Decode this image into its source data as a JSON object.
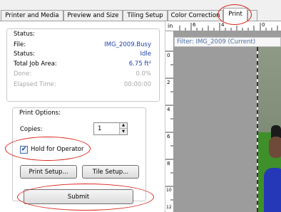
{
  "tabs": [
    "Printer and Media",
    "Preview and Size",
    "Tiling Setup",
    "Color Correction",
    "Print"
  ],
  "status": {
    "legend": "Status:",
    "rows": [
      {
        "label": "File:",
        "value": "IMG_2009.Busy"
      },
      {
        "label": "Status:",
        "value": "Idle"
      },
      {
        "label": "Total Job Area:",
        "value": "6.75 ft²"
      },
      {
        "label": "Done:",
        "value": "0.0%"
      },
      {
        "label": "Elapsed Time:",
        "value": "00:00:00"
      }
    ]
  },
  "print_options": {
    "legend": "Print Options:",
    "copies_label": "Copies:",
    "copies_value": "1",
    "hold_label": "Hold for Operator",
    "hold_checked": true,
    "print_setup_label": "Print Setup...",
    "tile_setup_label": "Tile Setup..."
  },
  "submit_label": "Submit",
  "ruler": {
    "unit": "in",
    "top_labels": [
      "6",
      "4",
      "0"
    ],
    "left_labels": [
      "0",
      "2",
      "4",
      "6",
      "8",
      "10",
      "12"
    ]
  },
  "preview": {
    "filter_label": "Filter: IMG_2009 (Current)"
  },
  "colors": {
    "annotation": "#d9261c",
    "value_text": "#1c3fa6",
    "canvas": "#9c9c9c"
  }
}
